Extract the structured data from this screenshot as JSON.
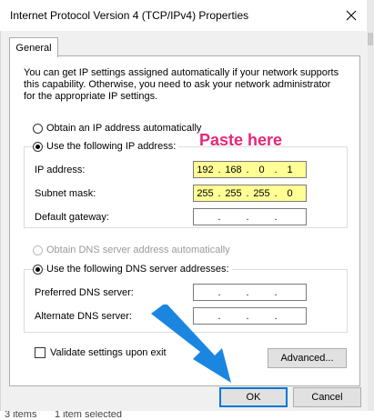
{
  "window": {
    "title": "Internet Protocol Version 4 (TCP/IPv4) Properties"
  },
  "tabs": [
    {
      "label": "General"
    }
  ],
  "description": "You can get IP settings assigned automatically if your network supports this capability. Otherwise, you need to ask your network administrator for the appropriate IP settings.",
  "ip_section": {
    "auto_label": "Obtain an IP address automatically",
    "manual_label": "Use the following IP address:",
    "fields": [
      {
        "label": "IP address:",
        "octets": [
          "192",
          "168",
          "0",
          "1"
        ]
      },
      {
        "label": "Subnet mask:",
        "octets": [
          "255",
          "255",
          "255",
          "0"
        ]
      },
      {
        "label": "Default gateway:",
        "octets": [
          "",
          "",
          "",
          ""
        ]
      }
    ]
  },
  "dns_section": {
    "auto_label": "Obtain DNS server address automatically",
    "manual_label": "Use the following DNS server addresses:",
    "fields": [
      {
        "label": "Preferred DNS server:",
        "octets": [
          "",
          "",
          "",
          ""
        ]
      },
      {
        "label": "Alternate DNS server:",
        "octets": [
          "",
          "",
          "",
          ""
        ]
      }
    ]
  },
  "validate_label": "Validate settings upon exit",
  "buttons": {
    "advanced": "Advanced...",
    "ok": "OK",
    "cancel": "Cancel"
  },
  "annotation": {
    "text": "Paste here",
    "color": "#e8267a",
    "highlight": "#ffff96"
  },
  "status_bar": {
    "items": "3 items",
    "selected": "1 item selected"
  },
  "colors": {
    "accent": "#0078d7",
    "arrow": "#1a86e0"
  }
}
